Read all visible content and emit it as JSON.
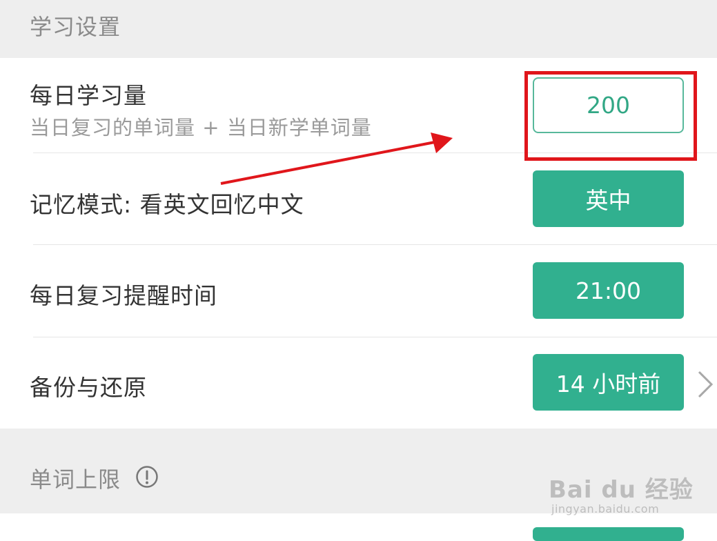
{
  "learning_settings": {
    "title": "学习设置",
    "daily_amount": {
      "label": "每日学习量",
      "subtitle": "当日复习的单词量 + 当日新学单词量",
      "value": "200"
    },
    "memory_mode": {
      "label": "记忆模式: 看英文回忆中文",
      "value": "英中"
    },
    "review_reminder": {
      "label": "每日复习提醒时间",
      "value": "21:00"
    },
    "backup_restore": {
      "label": "备份与还原",
      "value": "14 小时前"
    }
  },
  "word_limit": {
    "title": "单词上限",
    "info_icon": "info-circle-icon"
  },
  "annotation": {
    "highlight_color": "#e0161b",
    "arrow_color": "#e0161b"
  },
  "watermark": {
    "logo": "Bai du 经验",
    "url": "jingyan.baidu.com"
  },
  "colors": {
    "accent": "#31b08f",
    "section_bg": "#eeeeee",
    "title_text": "#333333",
    "muted_text": "#8a8a8a"
  }
}
